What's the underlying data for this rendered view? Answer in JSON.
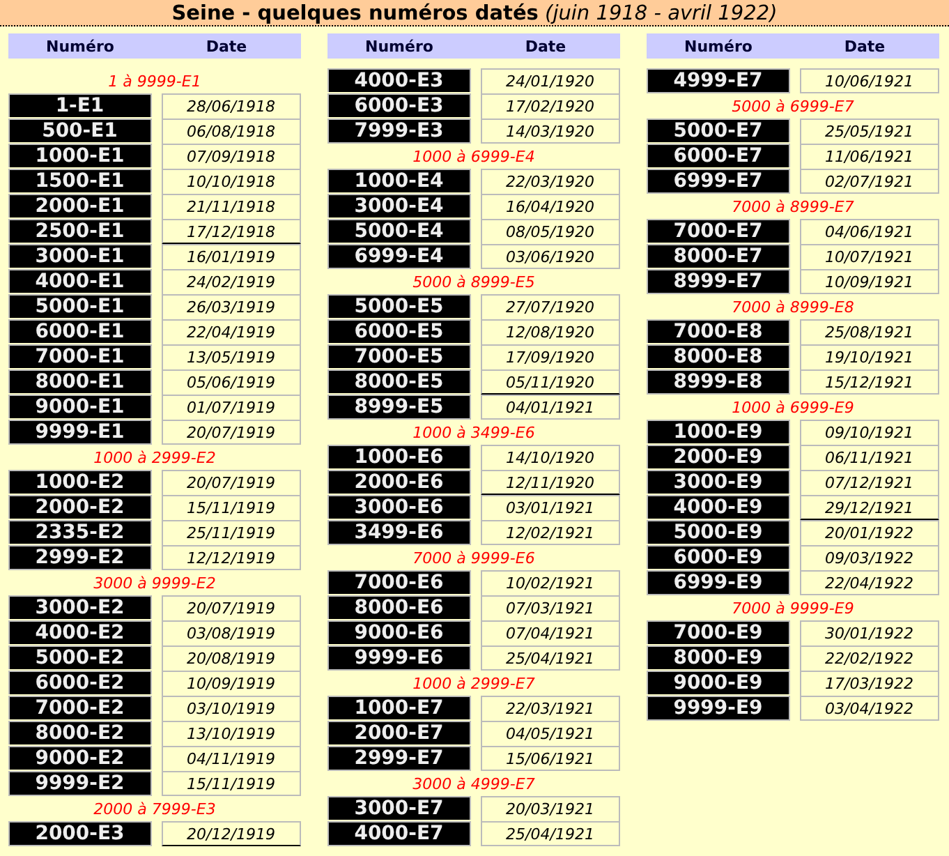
{
  "title": "**Seine - quelques numéros datés** *(juin 1918 - avril 1922)*",
  "columns": [
    {
      "headers": [
        "Numéro",
        "Date"
      ],
      "groups": [
        {
          "range": "1 à 9999-E1",
          "rows": [
            {
              "number": "1-E1",
              "date": "28/06/1918",
              "year_break": false
            },
            {
              "number": "500-E1",
              "date": "06/08/1918",
              "year_break": false
            },
            {
              "number": "1000-E1",
              "date": "07/09/1918",
              "year_break": false
            },
            {
              "number": "1500-E1",
              "date": "10/10/1918",
              "year_break": false
            },
            {
              "number": "2000-E1",
              "date": "21/11/1918",
              "year_break": false
            },
            {
              "number": "2500-E1",
              "date": "17/12/1918",
              "year_break": true
            },
            {
              "number": "3000-E1",
              "date": "16/01/1919",
              "year_break": false
            },
            {
              "number": "4000-E1",
              "date": "24/02/1919",
              "year_break": false
            },
            {
              "number": "5000-E1",
              "date": "26/03/1919",
              "year_break": false
            },
            {
              "number": "6000-E1",
              "date": "22/04/1919",
              "year_break": false
            },
            {
              "number": "7000-E1",
              "date": "13/05/1919",
              "year_break": false
            },
            {
              "number": "8000-E1",
              "date": "05/06/1919",
              "year_break": false
            },
            {
              "number": "9000-E1",
              "date": "01/07/1919",
              "year_break": false
            },
            {
              "number": "9999-E1",
              "date": "20/07/1919",
              "year_break": false
            }
          ]
        },
        {
          "range": "1000 à 2999-E2",
          "rows": [
            {
              "number": "1000-E2",
              "date": "20/07/1919",
              "year_break": false
            },
            {
              "number": "2000-E2",
              "date": "15/11/1919",
              "year_break": false
            },
            {
              "number": "2335-E2",
              "date": "25/11/1919",
              "year_break": false
            },
            {
              "number": "2999-E2",
              "date": "12/12/1919",
              "year_break": false
            }
          ]
        },
        {
          "range": "3000 à 9999-E2",
          "rows": [
            {
              "number": "3000-E2",
              "date": "20/07/1919",
              "year_break": false
            },
            {
              "number": "4000-E2",
              "date": "03/08/1919",
              "year_break": false
            },
            {
              "number": "5000-E2",
              "date": "20/08/1919",
              "year_break": false
            },
            {
              "number": "6000-E2",
              "date": "10/09/1919",
              "year_break": false
            },
            {
              "number": "7000-E2",
              "date": "03/10/1919",
              "year_break": false
            },
            {
              "number": "8000-E2",
              "date": "13/10/1919",
              "year_break": false
            },
            {
              "number": "9000-E2",
              "date": "04/11/1919",
              "year_break": false
            },
            {
              "number": "9999-E2",
              "date": "15/11/1919",
              "year_break": false
            }
          ]
        },
        {
          "range": "2000 à 7999-E3",
          "rows": [
            {
              "number": "2000-E3",
              "date": "20/12/1919",
              "year_break": true
            }
          ]
        }
      ]
    },
    {
      "headers": [
        "Numéro",
        "Date"
      ],
      "groups": [
        {
          "rows": [
            {
              "number": "4000-E3",
              "date": "24/01/1920",
              "year_break": false
            },
            {
              "number": "6000-E3",
              "date": "17/02/1920",
              "year_break": false
            },
            {
              "number": "7999-E3",
              "date": "14/03/1920",
              "year_break": false
            }
          ]
        },
        {
          "range": "1000 à 6999-E4",
          "rows": [
            {
              "number": "1000-E4",
              "date": "22/03/1920",
              "year_break": false
            },
            {
              "number": "3000-E4",
              "date": "16/04/1920",
              "year_break": false
            },
            {
              "number": "5000-E4",
              "date": "08/05/1920",
              "year_break": false
            },
            {
              "number": "6999-E4",
              "date": "03/06/1920",
              "year_break": false
            }
          ]
        },
        {
          "range": "5000 à 8999-E5",
          "rows": [
            {
              "number": "5000-E5",
              "date": "27/07/1920",
              "year_break": false
            },
            {
              "number": "6000-E5",
              "date": "12/08/1920",
              "year_break": false
            },
            {
              "number": "7000-E5",
              "date": "17/09/1920",
              "year_break": false
            },
            {
              "number": "8000-E5",
              "date": "05/11/1920",
              "year_break": true
            },
            {
              "number": "8999-E5",
              "date": "04/01/1921",
              "year_break": false
            }
          ]
        },
        {
          "range": "1000 à 3499-E6",
          "rows": [
            {
              "number": "1000-E6",
              "date": "14/10/1920",
              "year_break": false
            },
            {
              "number": "2000-E6",
              "date": "12/11/1920",
              "year_break": true
            },
            {
              "number": "3000-E6",
              "date": "03/01/1921",
              "year_break": false
            },
            {
              "number": "3499-E6",
              "date": "12/02/1921",
              "year_break": false
            }
          ]
        },
        {
          "range": "7000 à 9999-E6",
          "rows": [
            {
              "number": "7000-E6",
              "date": "10/02/1921",
              "year_break": false
            },
            {
              "number": "8000-E6",
              "date": "07/03/1921",
              "year_break": false
            },
            {
              "number": "9000-E6",
              "date": "07/04/1921",
              "year_break": false
            },
            {
              "number": "9999-E6",
              "date": "25/04/1921",
              "year_break": false
            }
          ]
        },
        {
          "range": "1000 à 2999-E7",
          "rows": [
            {
              "number": "1000-E7",
              "date": "22/03/1921",
              "year_break": false
            },
            {
              "number": "2000-E7",
              "date": "04/05/1921",
              "year_break": false
            },
            {
              "number": "2999-E7",
              "date": "15/06/1921",
              "year_break": false
            }
          ]
        },
        {
          "range": "3000 à 4999-E7",
          "rows": [
            {
              "number": "3000-E7",
              "date": "20/03/1921",
              "year_break": false
            },
            {
              "number": "4000-E7",
              "date": "25/04/1921",
              "year_break": false
            }
          ]
        }
      ]
    },
    {
      "headers": [
        "Numéro",
        "Date"
      ],
      "groups": [
        {
          "rows": [
            {
              "number": "4999-E7",
              "date": "10/06/1921",
              "year_break": false
            }
          ]
        },
        {
          "range": "5000 à 6999-E7",
          "rows": [
            {
              "number": "5000-E7",
              "date": "25/05/1921",
              "year_break": false
            },
            {
              "number": "6000-E7",
              "date": "11/06/1921",
              "year_break": false
            },
            {
              "number": "6999-E7",
              "date": "02/07/1921",
              "year_break": false
            }
          ]
        },
        {
          "range": "7000 à 8999-E7",
          "rows": [
            {
              "number": "7000-E7",
              "date": "04/06/1921",
              "year_break": false
            },
            {
              "number": "8000-E7",
              "date": "10/07/1921",
              "year_break": false
            },
            {
              "number": "8999-E7",
              "date": "10/09/1921",
              "year_break": false
            }
          ]
        },
        {
          "range": "7000 à 8999-E8",
          "rows": [
            {
              "number": "7000-E8",
              "date": "25/08/1921",
              "year_break": false
            },
            {
              "number": "8000-E8",
              "date": "19/10/1921",
              "year_break": false
            },
            {
              "number": "8999-E8",
              "date": "15/12/1921",
              "year_break": false
            }
          ]
        },
        {
          "range": "1000 à 6999-E9",
          "rows": [
            {
              "number": "1000-E9",
              "date": "09/10/1921",
              "year_break": false
            },
            {
              "number": "2000-E9",
              "date": "06/11/1921",
              "year_break": false
            },
            {
              "number": "3000-E9",
              "date": "07/12/1921",
              "year_break": false
            },
            {
              "number": "4000-E9",
              "date": "29/12/1921",
              "year_break": true
            },
            {
              "number": "5000-E9",
              "date": "20/01/1922",
              "year_break": false
            },
            {
              "number": "6000-E9",
              "date": "09/03/1922",
              "year_break": false
            },
            {
              "number": "6999-E9",
              "date": "22/04/1922",
              "year_break": false
            }
          ]
        },
        {
          "range": "7000 à 9999-E9",
          "rows": [
            {
              "number": "7000-E9",
              "date": "30/01/1922",
              "year_break": false
            },
            {
              "number": "8000-E9",
              "date": "22/02/1922",
              "year_break": false
            },
            {
              "number": "9000-E9",
              "date": "17/03/1922",
              "year_break": false
            },
            {
              "number": "9999-E9",
              "date": "03/04/1922",
              "year_break": false
            }
          ]
        }
      ]
    }
  ]
}
